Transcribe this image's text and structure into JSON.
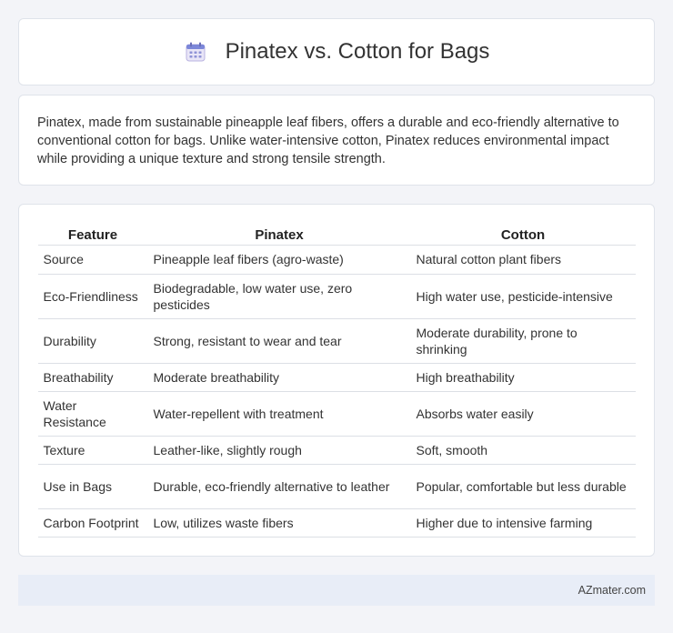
{
  "header": {
    "icon": "calendar-icon",
    "title": "Pinatex vs. Cotton for Bags"
  },
  "description": "Pinatex, made from sustainable pineapple leaf fibers, offers a durable and eco-friendly alternative to conventional cotton for bags. Unlike water-intensive cotton, Pinatex reduces environmental impact while providing a unique texture and strong tensile strength.",
  "table": {
    "headers": [
      "Feature",
      "Pinatex",
      "Cotton"
    ],
    "rows": [
      {
        "feature": "Source",
        "pinatex": "Pineapple leaf fibers (agro-waste)",
        "cotton": "Natural cotton plant fibers"
      },
      {
        "feature": "Eco-Friendliness",
        "pinatex": "Biodegradable, low water use, zero pesticides",
        "cotton": "High water use, pesticide-intensive"
      },
      {
        "feature": "Durability",
        "pinatex": "Strong, resistant to wear and tear",
        "cotton": "Moderate durability, prone to shrinking"
      },
      {
        "feature": "Breathability",
        "pinatex": "Moderate breathability",
        "cotton": "High breathability"
      },
      {
        "feature": "Water Resistance",
        "pinatex": "Water-repellent with treatment",
        "cotton": "Absorbs water easily"
      },
      {
        "feature": "Texture",
        "pinatex": "Leather-like, slightly rough",
        "cotton": "Soft, smooth"
      },
      {
        "feature": "Use in Bags",
        "pinatex": "Durable, eco-friendly alternative to leather",
        "cotton": "Popular, comfortable but less durable"
      },
      {
        "feature": "Carbon Footprint",
        "pinatex": "Low, utilizes waste fibers",
        "cotton": "Higher due to intensive farming"
      }
    ]
  },
  "footer": {
    "text": "AZmater.com"
  }
}
